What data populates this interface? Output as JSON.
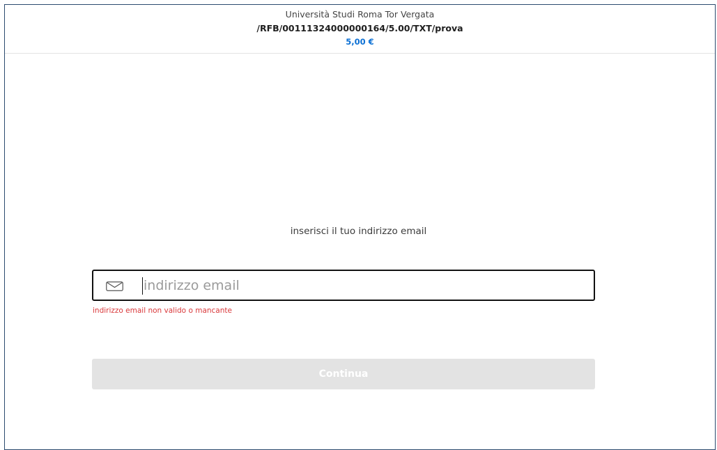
{
  "header": {
    "merchant": "Università Studi Roma Tor Vergata",
    "reference": "/RFB/00111324000000164/5.00/TXT/prova",
    "amount": "5,00 €"
  },
  "form": {
    "instruction": "inserisci il tuo indirizzo email",
    "email": {
      "placeholder": "indirizzo email",
      "value": "",
      "icon": "envelope-icon"
    },
    "error": "indirizzo email non valido o mancante",
    "continue_label": "Continua"
  },
  "colors": {
    "amount": "#0a6fd4",
    "error": "#d9383a",
    "button_disabled": "#e3e3e3",
    "frame_border": "#2b4a6e"
  }
}
